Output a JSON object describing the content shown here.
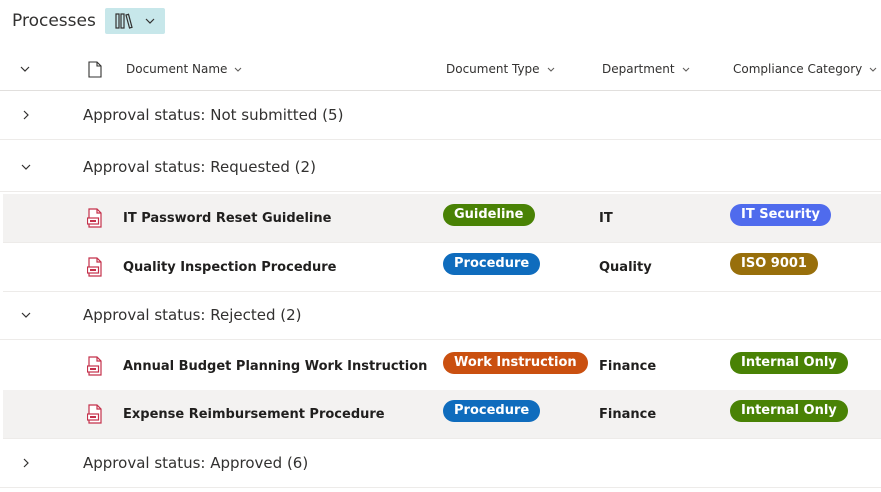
{
  "page": {
    "title": "Processes"
  },
  "view_button": {
    "icon": "library-icon",
    "chevron": "chevron-down-icon"
  },
  "columns": {
    "document_name": "Document Name",
    "document_type": "Document Type",
    "department": "Department",
    "compliance_category": "Compliance Category"
  },
  "groups": [
    {
      "label": "Approval status: Not submitted (5)",
      "expanded": false
    },
    {
      "label": "Approval status: Requested (2)",
      "expanded": true
    },
    {
      "label": "Approval status: Rejected (2)",
      "expanded": true
    },
    {
      "label": "Approval status: Approved (6)",
      "expanded": false
    }
  ],
  "rows": [
    {
      "name": "IT Password Reset Guideline",
      "type": "Guideline",
      "department": "IT",
      "compliance": "IT Security"
    },
    {
      "name": "Quality Inspection Procedure",
      "type": "Procedure",
      "department": "Quality",
      "compliance": "ISO 9001"
    },
    {
      "name": "Annual Budget Planning Work Instruction",
      "type": "Work Instruction",
      "department": "Finance",
      "compliance": "Internal Only"
    },
    {
      "name": "Expense Reimbursement Procedure",
      "type": "Procedure",
      "department": "Finance",
      "compliance": "Internal Only"
    }
  ],
  "colors": {
    "Guideline": "#498205",
    "Procedure": "#0f6cbd",
    "Work Instruction": "#ca5010",
    "IT Security": "#4f6bed",
    "ISO 9001": "#986f0b",
    "Internal Only": "#498205",
    "file_icon": "#c4314b",
    "view_button_bg": "#c7e7ea"
  }
}
